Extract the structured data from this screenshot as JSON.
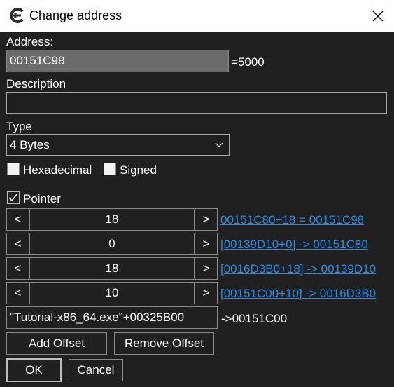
{
  "window": {
    "title": "Change address",
    "close_icon": "close-icon",
    "app_icon": "cheat-engine-logo"
  },
  "address": {
    "label": "Address:",
    "value": "00151C98",
    "result": "=5000"
  },
  "description": {
    "label": "Description",
    "value": ""
  },
  "type": {
    "label": "Type",
    "selected": "4 Bytes"
  },
  "options": {
    "hexadecimal": "Hexadecimal",
    "signed": "Signed",
    "pointer": "Pointer",
    "pointer_checked": true
  },
  "offsets": [
    {
      "value": "18",
      "dec": "<",
      "inc": ">",
      "link": "00151C80+18 = 00151C98"
    },
    {
      "value": "0",
      "dec": "<",
      "inc": ">",
      "link": "[00139D10+0] -> 00151C80"
    },
    {
      "value": "18",
      "dec": "<",
      "inc": ">",
      "link": "[0016D3B0+18] -> 00139D10"
    },
    {
      "value": "10",
      "dec": "<",
      "inc": ">",
      "link": "[00151C00+10] -> 0016D3B0"
    }
  ],
  "base": {
    "value": "\"Tutorial-x86_64.exe\"+00325B00",
    "result": "->00151C00"
  },
  "buttons": {
    "add_offset": "Add Offset",
    "remove_offset": "Remove Offset",
    "ok": "OK",
    "cancel": "Cancel"
  },
  "colors": {
    "background": "#202020",
    "link": "#2a8ae6",
    "titlebar": "#ffffff"
  }
}
